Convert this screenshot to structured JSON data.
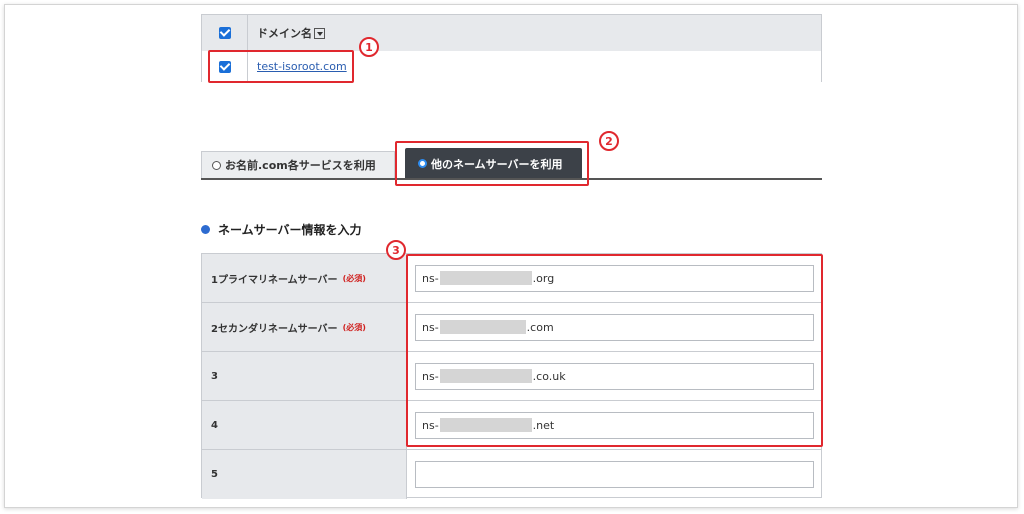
{
  "domain_table": {
    "header_label": "ドメイン名",
    "rows": [
      {
        "domain": "test-isoroot.com",
        "checked": true
      }
    ],
    "header_checked": true
  },
  "annotations": {
    "n1": "1",
    "n2": "2",
    "n3": "3",
    "color": "#e0282e"
  },
  "tabs": [
    {
      "label": "お名前.com各サービスを利用",
      "selected": false
    },
    {
      "label": "他のネームサーバーを利用",
      "selected": true
    }
  ],
  "section_title": "ネームサーバー情報を入力",
  "ns_table": {
    "required_label": "(必須)",
    "rows": [
      {
        "label": "1プライマリネームサーバー",
        "required": true,
        "prefix": "ns-",
        "suffix": ".org"
      },
      {
        "label": "2セカンダリネームサーバー",
        "required": true,
        "prefix": "ns-",
        "suffix": ".com"
      },
      {
        "label": "3",
        "required": false,
        "prefix": "ns-",
        "suffix": ".co.uk"
      },
      {
        "label": "4",
        "required": false,
        "prefix": "ns-",
        "suffix": ".net"
      },
      {
        "label": "5",
        "required": false,
        "prefix": "",
        "suffix": ""
      }
    ]
  },
  "colors": {
    "accent": "#2d6bd0",
    "active_tab": "#3c4148",
    "highlight": "#e0282e"
  }
}
